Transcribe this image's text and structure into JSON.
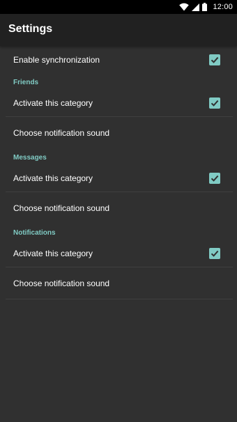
{
  "status_bar": {
    "time": "12:00",
    "icons": [
      "wifi-icon",
      "signal-icon",
      "battery-icon"
    ]
  },
  "app_bar": {
    "title": "Settings"
  },
  "colors": {
    "accent": "#80cbc4",
    "background": "#303030",
    "toolbar": "#212121",
    "status_bar": "#000000"
  },
  "settings": {
    "sync": {
      "label": "Enable synchronization",
      "checked": true
    },
    "sections": [
      {
        "title": "Friends",
        "activate_label": "Activate this category",
        "activate_checked": true,
        "sound_label": "Choose notification sound"
      },
      {
        "title": "Messages",
        "activate_label": "Activate this category",
        "activate_checked": true,
        "sound_label": "Choose notification sound"
      },
      {
        "title": "Notifications",
        "activate_label": "Activate this category",
        "activate_checked": true,
        "sound_label": "Choose notification sound"
      }
    ]
  }
}
